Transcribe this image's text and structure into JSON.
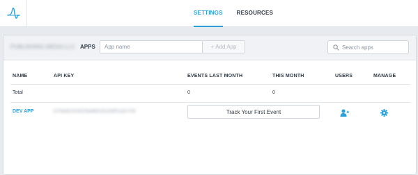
{
  "nav": {
    "tabs": [
      {
        "label": "SETTINGS",
        "active": true
      },
      {
        "label": "RESOURCES",
        "active": false
      }
    ]
  },
  "apps_panel": {
    "org_name": "PUBLISHING MEDIA LLC",
    "title": "APPS",
    "app_name_placeholder": "App name",
    "add_app_label": "Add App",
    "search_placeholder": "Search apps"
  },
  "table": {
    "columns": [
      "NAME",
      "API KEY",
      "EVENTS LAST MONTH",
      "THIS MONTH",
      "USERS",
      "MANAGE"
    ],
    "total_row": {
      "name": "Total",
      "events_last_month": "0",
      "this_month": "0"
    },
    "app_row": {
      "name": "DEV APP",
      "api_key": "b7f3a9c2e4d1f6a8b0c5e2d9f1a3c7e6",
      "track_label": "Track Your First Event",
      "users_icon": "add-user-icon",
      "manage_icon": "gear-icon"
    }
  },
  "colors": {
    "accent": "#2a9fd8",
    "text": "#2f3a45",
    "background": "#e7eaee"
  }
}
